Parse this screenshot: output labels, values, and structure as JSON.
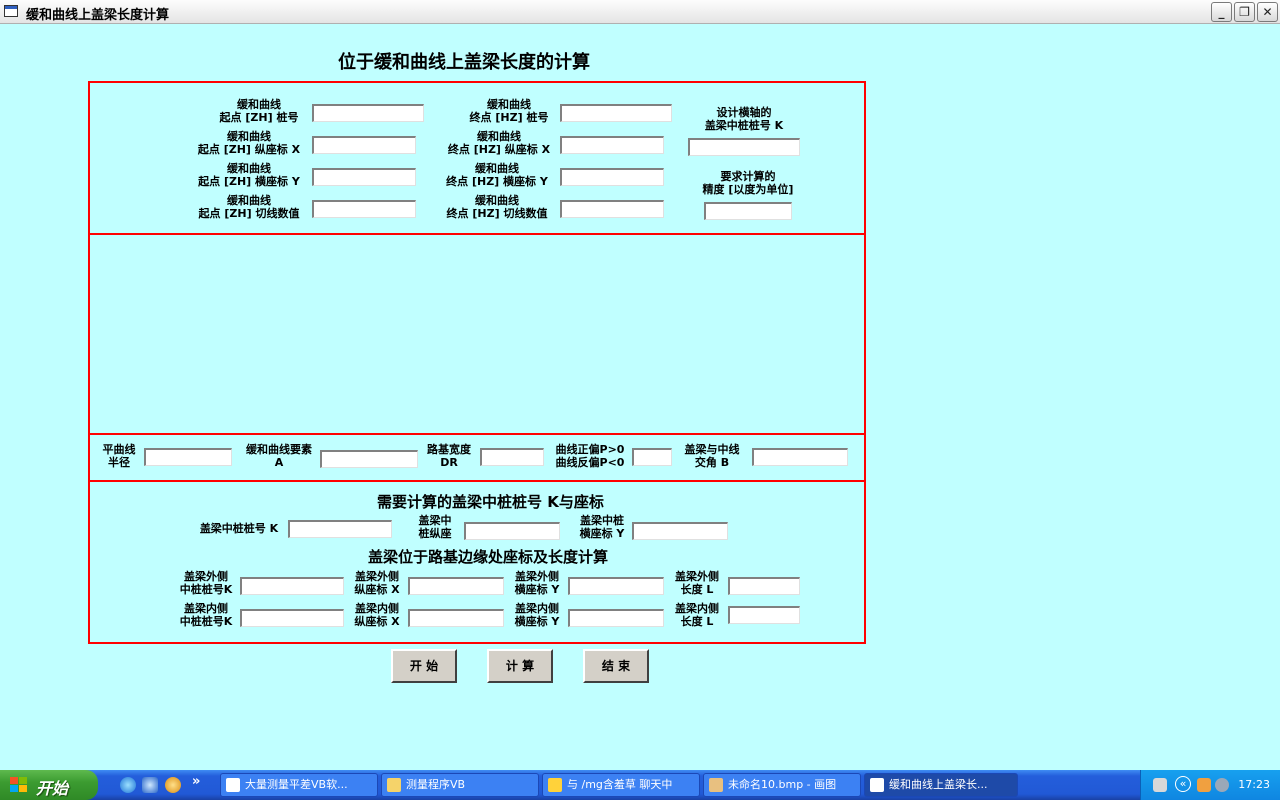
{
  "window": {
    "title": "缓和曲线上盖梁长度计算",
    "minimize_glyph": "_",
    "restore_glyph": "❐",
    "close_glyph": "✕"
  },
  "form": {
    "heading": "位于缓和曲线上盖梁长度的计算",
    "top": {
      "zh_stake_l1": "缓和曲线",
      "zh_stake_l2": "起点 [ZH] 桩号",
      "zh_x_l1": "缓和曲线",
      "zh_x_l2": "起点 [ZH] 纵座标 X",
      "zh_y_l1": "缓和曲线",
      "zh_y_l2": "起点 [ZH] 横座标 Y",
      "zh_tan_l1": "缓和曲线",
      "zh_tan_l2": "起点 [ZH] 切线数值",
      "hz_stake_l1": "缓和曲线",
      "hz_stake_l2": "终点 [HZ] 桩号",
      "hz_x_l1": "缓和曲线",
      "hz_x_l2": "终点 [HZ] 纵座标 X",
      "hz_y_l1": "缓和曲线",
      "hz_y_l2": "终点 [HZ] 横座标 Y",
      "hz_tan_l1": "缓和曲线",
      "hz_tan_l2": "终点 [HZ] 切线数值",
      "k_l1": "设计横轴的",
      "k_l2": "盖梁中桩桩号 K",
      "prec_l1": "要求计算的",
      "prec_l2": "精度 [以度为单位]"
    },
    "params": {
      "radius_l1": "平曲线",
      "radius_l2": "半径",
      "a_l1": "缓和曲线要素",
      "a_l2": "A",
      "dr_l1": "路基宽度",
      "dr_l2": "DR",
      "p_l1": "曲线正偏P>0",
      "p_l2": "曲线反偏P<0",
      "b_l1": "盖梁与中线",
      "b_l2": "交角  B"
    },
    "center": {
      "title": "需要计算的盖梁中桩桩号 K与座标",
      "k_label": "盖梁中桩桩号 K",
      "x_l1": "盖梁中",
      "x_l2": "桩纵座",
      "y_l1": "盖梁中桩",
      "y_l2": "横座标 Y"
    },
    "edge": {
      "title": "盖梁位于路基边缘处座标及长度计算",
      "out_k_l1": "盖梁外侧",
      "out_k_l2": "中桩桩号K",
      "out_x_l1": "盖梁外侧",
      "out_x_l2": "纵座标 X",
      "out_y_l1": "盖梁外侧",
      "out_y_l2": "横座标 Y",
      "out_len_l1": "盖梁外侧",
      "out_len_l2": "长度 L",
      "in_k_l1": "盖梁内侧",
      "in_k_l2": "中桩桩号K",
      "in_x_l1": "盖梁内侧",
      "in_x_l2": "纵座标 X",
      "in_y_l1": "盖梁内侧",
      "in_y_l2": "横座标 Y",
      "in_len_l1": "盖梁内侧",
      "in_len_l2": "长度 L"
    },
    "buttons": {
      "start": "开 始",
      "calc": "计 算",
      "end": "结 束"
    }
  },
  "taskbar": {
    "start_label": "开始",
    "more_glyph": "»",
    "tasks": [
      {
        "label": "大量测量平差VB软..."
      },
      {
        "label": "测量程序VB"
      },
      {
        "label": "与 /mg含羞草 聊天中"
      },
      {
        "label": "未命名10.bmp - 画图"
      },
      {
        "label": "缓和曲线上盖梁长..."
      }
    ],
    "tray_more_glyph": "«",
    "clock": "17:23"
  }
}
